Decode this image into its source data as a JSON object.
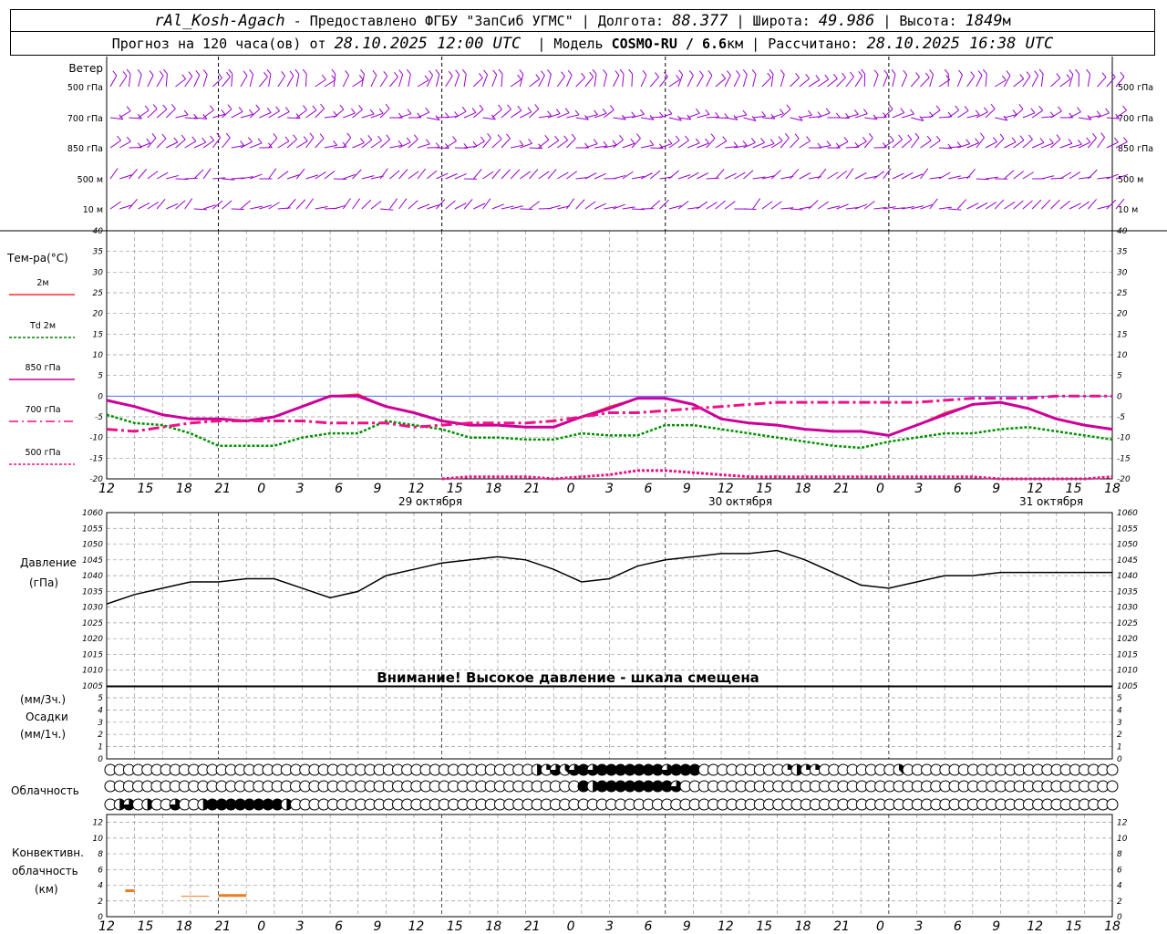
{
  "header": {
    "station": "rAl_Kosh-Agach",
    "provider": "Предоставлено ФГБУ \"ЗапСиб УГМС\"",
    "lon_label": "Долгота:",
    "lon_value": "88.377",
    "lat_label": "Широта:",
    "lat_value": "49.986",
    "alt_label": "Высота:",
    "alt_value": "1849",
    "alt_unit": "м",
    "forecast_prefix": "Прогноз на 120 часа(ов) от",
    "forecast_start": "28.10.2025 12:00 UTC",
    "model_label": "Модель",
    "model_name": "COSMO-RU / 6.6",
    "model_unit": "км",
    "calc_label": "Рассчитано:",
    "calc_time": "28.10.2025 16:38 UTC"
  },
  "wind_panel": {
    "title": "Ветер",
    "levels": [
      "500 гПа",
      "700 гПа",
      "850 гПа",
      "500 м",
      "10  м"
    ]
  },
  "temp_panel": {
    "title": "Тем-ра(°С)",
    "legend": [
      {
        "label": "2м",
        "color": "#ff2a2a"
      },
      {
        "label": "Td 2м",
        "color": "#008000"
      },
      {
        "label": "850 гПа",
        "color": "#cc0099"
      },
      {
        "label": "700 гПа",
        "color": "#ee1188"
      },
      {
        "label": "500 гПа",
        "color": "#ee1188"
      }
    ]
  },
  "x_axis": {
    "hour_labels": [
      "12",
      "15",
      "18",
      "21",
      "0",
      "3",
      "6",
      "9",
      "12",
      "15",
      "18",
      "21",
      "0",
      "3",
      "6",
      "9",
      "12",
      "15",
      "18",
      "21",
      "0",
      "3",
      "6",
      "9",
      "12",
      "15",
      "18"
    ],
    "date_labels": [
      "29 октября",
      "30 октября",
      "31 октября"
    ]
  },
  "pressure_panel": {
    "title_1": "Давление",
    "title_2": "(гПа)",
    "warning": "Внимание! Высокое давление - шкала смещена"
  },
  "precip_panel": {
    "title_1": "(мм/3ч.)",
    "title_2": "Осадки",
    "title_3": "(мм/1ч.)"
  },
  "cloud_panel": {
    "title": "Облачность"
  },
  "conv_panel": {
    "title_1": "Конвективн.",
    "title_2": "облачность",
    "title_3": "(км)"
  },
  "chart_data": [
    {
      "type": "line",
      "name": "temperature",
      "x_hours": [
        0,
        3,
        6,
        9,
        12,
        15,
        18,
        21,
        24,
        27,
        30,
        33,
        36,
        39,
        42,
        45,
        48,
        51,
        54,
        57,
        60,
        63,
        66,
        69,
        72,
        75,
        78,
        81,
        84,
        87,
        90,
        93,
        96,
        99,
        102,
        105,
        108
      ],
      "ylim": [
        -20,
        40
      ],
      "yticks": [
        -20,
        -15,
        -10,
        -5,
        0,
        5,
        10,
        15,
        20,
        25,
        30,
        35,
        40
      ],
      "series": [
        {
          "name": "2м",
          "color": "#ff3030",
          "values": [
            -1,
            -2.5,
            -4.5,
            -5.5,
            -5.5,
            -6,
            -5,
            -2.5,
            0,
            0.5,
            -2.5,
            -4,
            -6,
            -7,
            -7,
            -7.5,
            -7.5,
            -5,
            -2.5,
            -0.5,
            -0.5,
            -2,
            -5.5,
            -6.5,
            -7,
            -8,
            -8.5,
            -8.5,
            -9.5,
            -7,
            -4,
            -2,
            -1.5,
            -3,
            -5.5,
            -7,
            -8
          ]
        },
        {
          "name": "Td 2м",
          "color": "#009000",
          "values": [
            -4.5,
            -6.5,
            -7,
            -9,
            -12,
            -12,
            -12,
            -10,
            -9,
            -9,
            -6,
            -7,
            -8,
            -10,
            -10,
            -10.5,
            -10.5,
            -9,
            -9.5,
            -9.5,
            -7,
            -7,
            -8,
            -9,
            -10,
            -11,
            -12,
            -12.5,
            -11,
            -10,
            -9,
            -9,
            -8,
            -7.5,
            -8.5,
            -9.5,
            -10.5
          ]
        },
        {
          "name": "850 гПа",
          "color": "#cc0099",
          "values": [
            -1,
            -2.5,
            -4.5,
            -5.5,
            -5.5,
            -6,
            -5,
            -2.5,
            0,
            0,
            -2.5,
            -4,
            -6,
            -7,
            -7,
            -7.5,
            -7.5,
            -5,
            -3,
            -0.5,
            -0.5,
            -2,
            -5.5,
            -6.5,
            -7,
            -8,
            -8.5,
            -8.5,
            -9.5,
            -7,
            -4.5,
            -2,
            -1.5,
            -3,
            -5.5,
            -7,
            -8
          ]
        },
        {
          "name": "700 гПа",
          "color": "#ee1188",
          "values": [
            -8,
            -8.5,
            -7.5,
            -6.5,
            -6,
            -6,
            -6,
            -6,
            -6.5,
            -6.5,
            -6.5,
            -7.5,
            -7,
            -6.5,
            -6.5,
            -6.5,
            -6,
            -5,
            -4,
            -4,
            -3.5,
            -3,
            -2.5,
            -2,
            -1.5,
            -1.5,
            -1.5,
            -1.5,
            -1.5,
            -1.5,
            -1,
            -0.5,
            -0.5,
            -0.5,
            0,
            0,
            0
          ]
        },
        {
          "name": "500 гПа",
          "color": "#ee1188",
          "values": [
            null,
            null,
            null,
            null,
            null,
            null,
            null,
            null,
            null,
            null,
            null,
            null,
            -20,
            -19.5,
            -19.5,
            -19.5,
            -20,
            -19.5,
            -19,
            -18,
            -18,
            -18.5,
            -19,
            -19.5,
            -19.5,
            -19.5,
            -19.5,
            -19.5,
            -19.5,
            -19.5,
            -19.5,
            -19.5,
            -20,
            -20,
            -20,
            -20,
            -19.5
          ]
        }
      ]
    },
    {
      "type": "line",
      "name": "pressure",
      "x_hours": [
        0,
        3,
        6,
        9,
        12,
        15,
        18,
        21,
        24,
        27,
        30,
        33,
        36,
        39,
        42,
        45,
        48,
        51,
        54,
        57,
        60,
        63,
        66,
        69,
        72,
        75,
        78,
        81,
        84,
        87,
        90,
        93,
        96,
        99,
        102,
        105,
        108
      ],
      "ylim": [
        1005,
        1060
      ],
      "yticks": [
        1005,
        1010,
        1015,
        1020,
        1025,
        1030,
        1035,
        1040,
        1045,
        1050,
        1055,
        1060
      ],
      "values": [
        1031,
        1034,
        1036,
        1038,
        1038,
        1039,
        1039,
        1036,
        1033,
        1035,
        1040,
        1042,
        1044,
        1045,
        1046,
        1045,
        1042,
        1038,
        1039,
        1043,
        1045,
        1046,
        1047,
        1047,
        1048,
        1045,
        1041,
        1037,
        1036,
        1038,
        1040,
        1040,
        1041,
        1041,
        1041,
        1041,
        1041
      ]
    },
    {
      "type": "bar",
      "name": "precipitation",
      "ylim": [
        0,
        5
      ],
      "yticks": [
        0,
        1,
        2,
        3,
        4,
        5
      ],
      "values": []
    },
    {
      "type": "table",
      "name": "cloudiness",
      "note": "octas per hour, 3 layers",
      "rows": [
        [
          0,
          0,
          0,
          0,
          0,
          0,
          0,
          0,
          0,
          0,
          0,
          0,
          0,
          0,
          0,
          0,
          0,
          0,
          0,
          0,
          0,
          0,
          0,
          0,
          0,
          0,
          0,
          0,
          0,
          0,
          0,
          0,
          0,
          0,
          0,
          0,
          0,
          0,
          0,
          0,
          0,
          0,
          0,
          0,
          0,
          0,
          0,
          0,
          0,
          0,
          0,
          0,
          0,
          0,
          0,
          0,
          0,
          0,
          0,
          0,
          0,
          0,
          0,
          0,
          0,
          0,
          0,
          0,
          0,
          0,
          0,
          0,
          0,
          0,
          0,
          0,
          0,
          0,
          0,
          0,
          0,
          0,
          0,
          0,
          0,
          0,
          0,
          0,
          0,
          0,
          0,
          0,
          0,
          0,
          0,
          0,
          0,
          0,
          0,
          0,
          0,
          0,
          0,
          0,
          0,
          0,
          0,
          0,
          0
        ],
        [
          0,
          0,
          0,
          0,
          0,
          0,
          0,
          0,
          0,
          0,
          0,
          0,
          0,
          0,
          0,
          0,
          0,
          0,
          0,
          0,
          0,
          0,
          0,
          0,
          0,
          0,
          0,
          0,
          0,
          0,
          0,
          0,
          0,
          0,
          0,
          0,
          0,
          0,
          0,
          0,
          0,
          0,
          0,
          0,
          0,
          0,
          0,
          0,
          0,
          0,
          0,
          0,
          0,
          0,
          0,
          0,
          0,
          0,
          0,
          0,
          0,
          0,
          0,
          0,
          0,
          0,
          0,
          0,
          0,
          0,
          0,
          0,
          0,
          0,
          0,
          0,
          0,
          0,
          0,
          0,
          0,
          0,
          0,
          0,
          0,
          0,
          0,
          0,
          0,
          0,
          0,
          0,
          0,
          0,
          0,
          0,
          0,
          0,
          0,
          0,
          0,
          0,
          0,
          0,
          0,
          0,
          0,
          0,
          0
        ],
        [
          0,
          0,
          0,
          0,
          0,
          0,
          0,
          0,
          0,
          0,
          0,
          0,
          0,
          0,
          0,
          0,
          0,
          0,
          0,
          0,
          0,
          0,
          0,
          0,
          0,
          0,
          0,
          0,
          0,
          0,
          0,
          0,
          0,
          0,
          0,
          0,
          0,
          0,
          0,
          0,
          0,
          0,
          0,
          0,
          0,
          0,
          0,
          0,
          0,
          0,
          0,
          0,
          0,
          0,
          0,
          0,
          0,
          0,
          0,
          0,
          0,
          0,
          0,
          0,
          0,
          0,
          0,
          0,
          0,
          0,
          0,
          0,
          0,
          0,
          0,
          0,
          0,
          0,
          0,
          0,
          0,
          0,
          0,
          0,
          0,
          0,
          0,
          0,
          0,
          0,
          0,
          0,
          0,
          0,
          0,
          0,
          0,
          0,
          0,
          0,
          0,
          0,
          0,
          0,
          0,
          0,
          0,
          0,
          0
        ]
      ]
    },
    {
      "type": "bar",
      "name": "convective_cloud",
      "ylim": [
        0,
        13
      ],
      "yticks": [
        0,
        2,
        4,
        6,
        8,
        10,
        12
      ],
      "segments": [
        {
          "start_h": 2,
          "end_h": 3,
          "base": 3.3,
          "color": "#e87d1e",
          "weight": 3
        },
        {
          "start_h": 8,
          "end_h": 11,
          "base": 2.6,
          "color": "#e87d1e",
          "weight": 1
        },
        {
          "start_h": 12,
          "end_h": 15,
          "base": 2.7,
          "color": "#e87d1e",
          "weight": 3
        }
      ]
    }
  ]
}
